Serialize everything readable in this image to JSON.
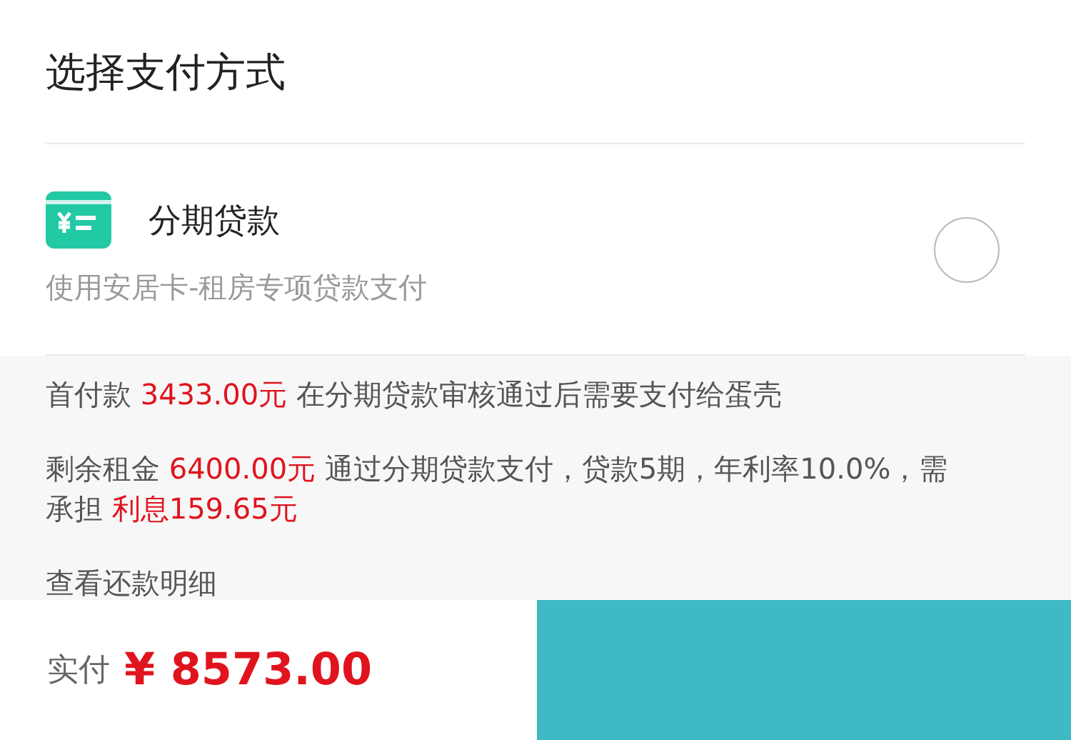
{
  "title": "选择支付方式",
  "payment_option": {
    "label": "分期贷款",
    "description": "使用安居卡-租房专项贷款支付",
    "selected": false
  },
  "details": [
    {
      "parts": [
        {
          "text": "首付款 ",
          "highlight": false
        },
        {
          "text": "3433.00元",
          "highlight": true
        },
        {
          "text": " 在分期贷款审核通过后需要支付给蛋壳",
          "highlight": false
        }
      ]
    },
    {
      "parts": [
        {
          "text": "剩余租金 ",
          "highlight": false
        },
        {
          "text": "6400.00元",
          "highlight": true
        },
        {
          "text": " 通过分期贷款支付，贷款5期，年利率10.0%，需承担 ",
          "highlight": false
        },
        {
          "text": "利息159.65元",
          "highlight": true
        }
      ]
    }
  ],
  "repayment_link": "查看还款明细",
  "footer": {
    "label": "实付",
    "amount": "¥ 8573.00"
  }
}
